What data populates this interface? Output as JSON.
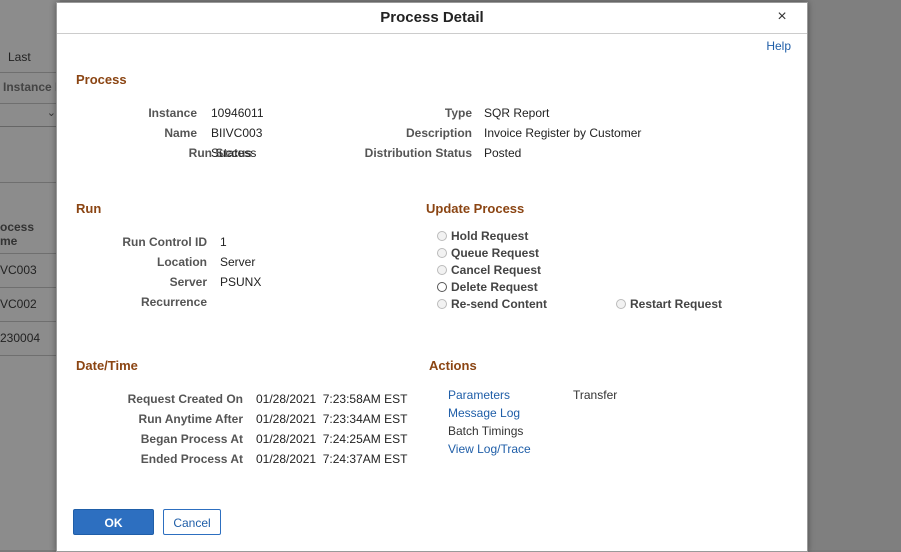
{
  "background": {
    "header_cell": "Last",
    "instance_col": "Instance F",
    "process_header": "ocess\nme",
    "rows": [
      "VC003",
      "VC002",
      "230004"
    ]
  },
  "modal": {
    "title": "Process Detail",
    "close_symbol": "×",
    "help": "Help",
    "process": {
      "heading": "Process",
      "instance_label": "Instance",
      "instance_value": "10946011",
      "name_label": "Name",
      "name_value": "BIIVC003",
      "run_status_label": "Run Status",
      "run_status_value": "Success",
      "type_label": "Type",
      "type_value": "SQR Report",
      "description_label": "Description",
      "description_value": "Invoice Register by Customer",
      "distribution_label": "Distribution Status",
      "distribution_value": "Posted"
    },
    "run": {
      "heading": "Run",
      "run_control_label": "Run Control ID",
      "run_control_value": "1",
      "location_label": "Location",
      "location_value": "Server",
      "server_label": "Server",
      "server_value": "PSUNX",
      "recurrence_label": "Recurrence",
      "recurrence_value": ""
    },
    "update": {
      "heading": "Update Process",
      "options": {
        "hold": "Hold Request",
        "queue": "Queue Request",
        "cancel": "Cancel Request",
        "delete": "Delete Request",
        "resend": "Re-send Content",
        "restart": "Restart Request"
      }
    },
    "datetime": {
      "heading": "Date/Time",
      "created_label": "Request Created On",
      "created_value": "01/28/2021  7:23:58AM EST",
      "anytime_label": "Run Anytime After",
      "anytime_value": "01/28/2021  7:23:34AM EST",
      "began_label": "Began Process At",
      "began_value": "01/28/2021  7:24:25AM EST",
      "ended_label": "Ended Process At",
      "ended_value": "01/28/2021  7:24:37AM EST"
    },
    "actions": {
      "heading": "Actions",
      "parameters": "Parameters",
      "transfer": "Transfer",
      "message_log": "Message Log",
      "batch_timings": "Batch Timings",
      "view_log": "View Log/Trace"
    },
    "buttons": {
      "ok": "OK",
      "cancel": "Cancel"
    }
  },
  "colors": {
    "section_heading": "#8b4513",
    "link": "#1f5ea8",
    "primary_button": "#2d6fc0"
  }
}
